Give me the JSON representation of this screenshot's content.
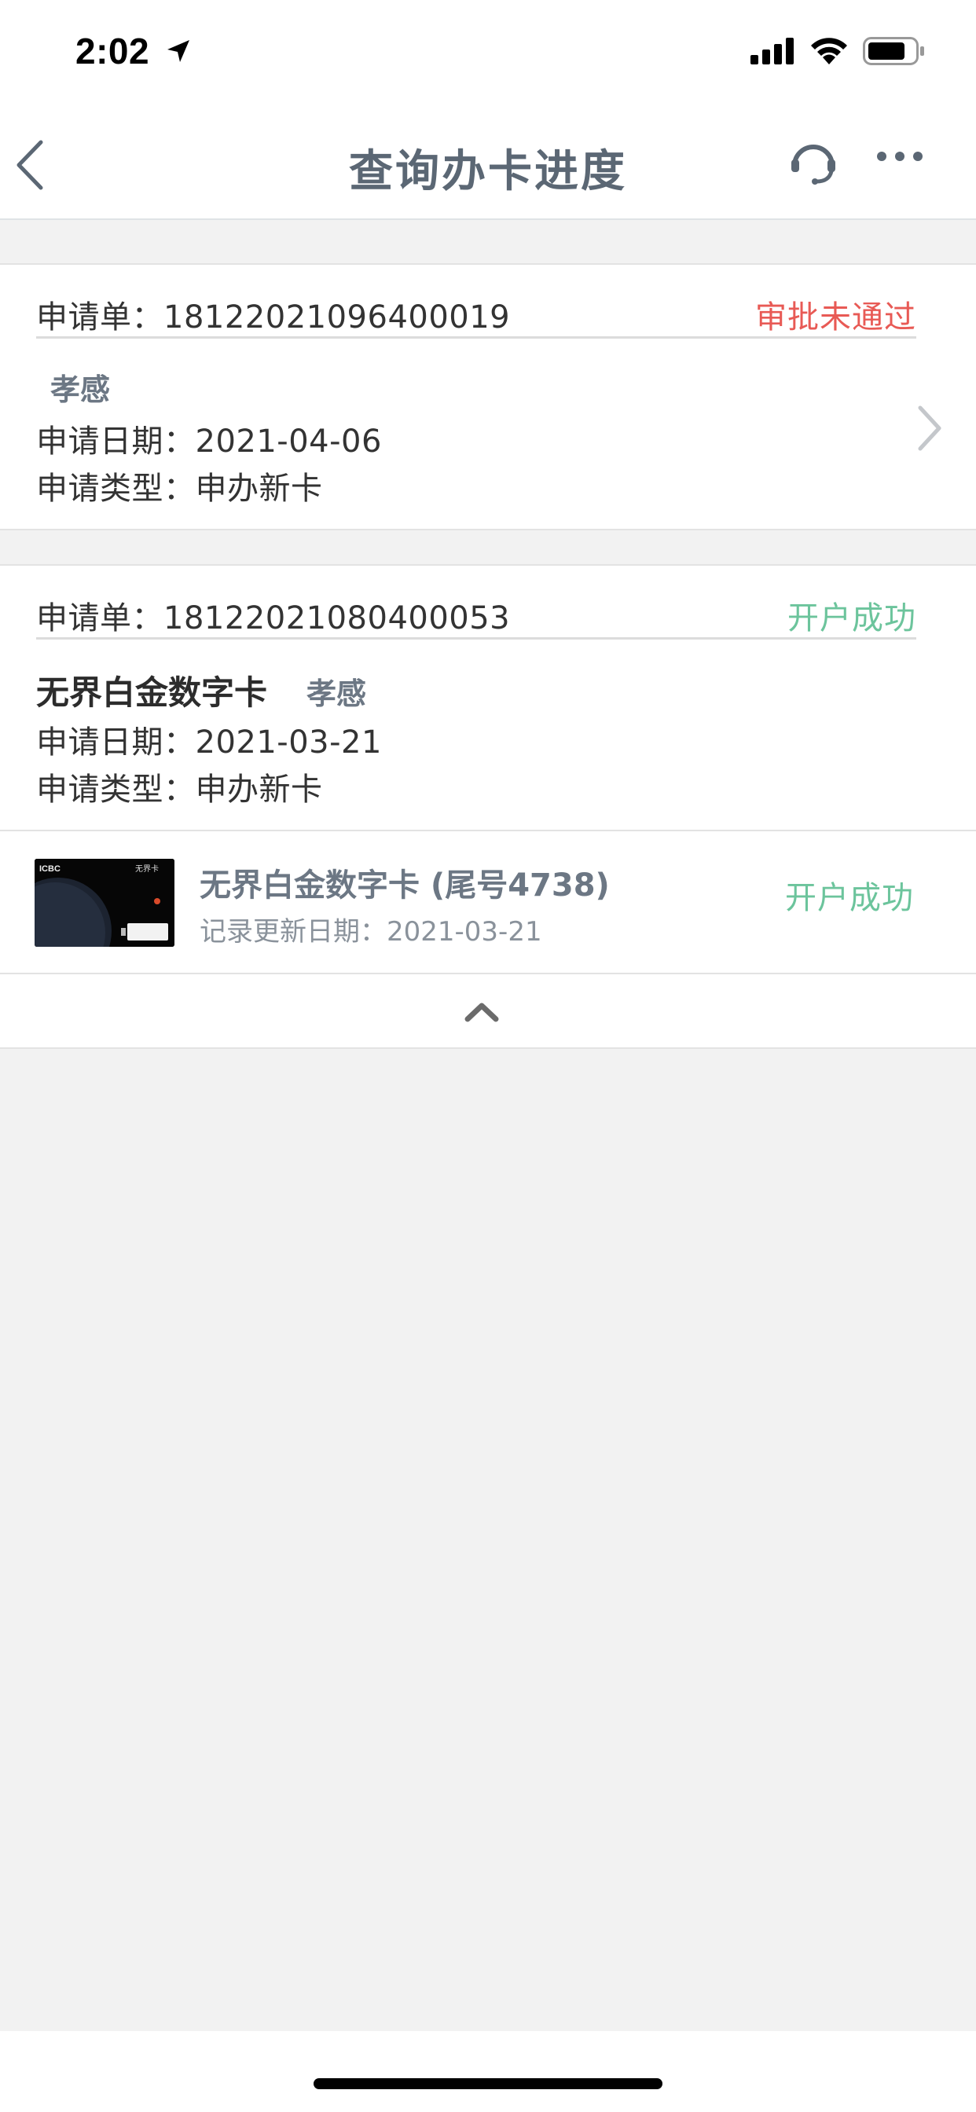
{
  "status_bar": {
    "time": "2:02"
  },
  "nav": {
    "title": "查询办卡进度"
  },
  "applications": [
    {
      "number_label": "申请单：18122021096400019",
      "status": "审批未通过",
      "status_color": "#e85a55",
      "card_name": "",
      "city": "孝感",
      "date_line": "申请日期：2021-04-06",
      "type_line": "申请类型：申办新卡"
    },
    {
      "number_label": "申请单：18122021080400053",
      "status": "开户成功",
      "status_color": "#6cc49c",
      "card_name": "无界白金数字卡",
      "city": "孝感",
      "date_line": "申请日期：2021-03-21",
      "type_line": "申请类型：申办新卡"
    }
  ],
  "card_detail": {
    "title": "无界白金数字卡 (尾号4738)",
    "updated": "记录更新日期：2021-03-21",
    "status": "开户成功",
    "card_logo_text": "ICBC",
    "card_brand_text": "无界卡"
  },
  "colors": {
    "accent_fail": "#e85a55",
    "accent_success": "#6cc49c",
    "title_gray": "#5b6774",
    "background": "#f2f2f2"
  }
}
